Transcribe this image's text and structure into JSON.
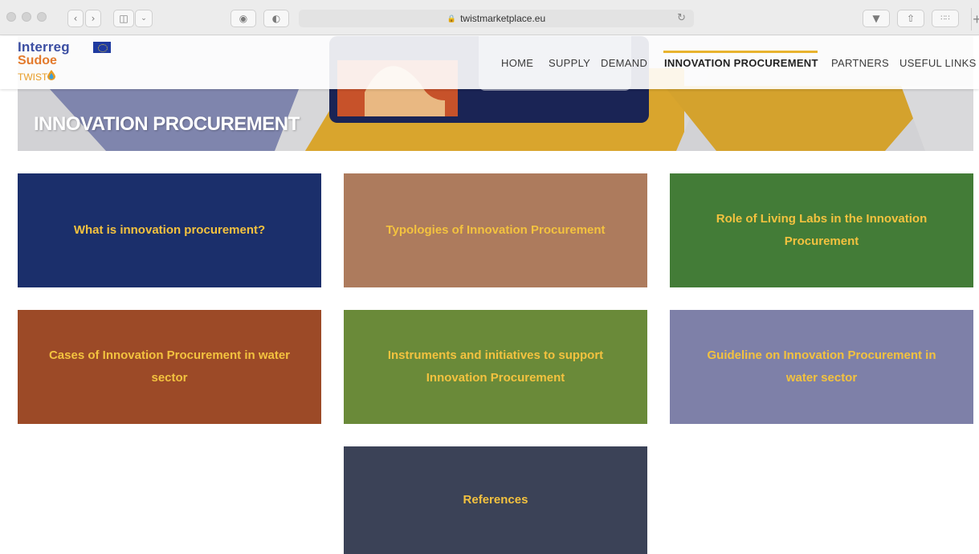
{
  "browser": {
    "url": "twistmarketplace.eu",
    "icons": [
      "back-icon",
      "forward-icon",
      "sidebar-icon",
      "chevron-down-icon",
      "privacy-icon",
      "shield-icon",
      "lock-icon",
      "reload-icon",
      "download-icon",
      "share-icon",
      "tabs-icon",
      "plus-icon"
    ]
  },
  "logo": {
    "interreg": "Interreg",
    "sudoe": "Sudoe",
    "twist": "TWIST"
  },
  "nav": {
    "home": "HOME",
    "supply": "SUPPLY",
    "demand": "DEMAND",
    "innovation": "INNOVATION PROCUREMENT",
    "partners": "PARTNERS",
    "useful_links": "USEFUL LINKS",
    "active": "INNOVATION PROCUREMENT"
  },
  "banner": {
    "title": "INNOVATION PROCUREMENT"
  },
  "tiles": [
    {
      "label": "What is innovation procurement?",
      "color": "#1b2f6b"
    },
    {
      "label": "Typologies of Innovation Procurement",
      "color": "#ad7b5d"
    },
    {
      "label": "Role of Living Labs in the Innovation Procurement",
      "color": "#437c37"
    },
    {
      "label": "Cases of Innovation Procurement in water sector",
      "color": "#9c4a27"
    },
    {
      "label": "Instruments and initiatives to support Innovation Procurement",
      "color": "#6a8a39"
    },
    {
      "label": "Guideline on Innovation Procurement in water sector",
      "color": "#7e80a8"
    },
    {
      "label": "References",
      "color": "#3b4257"
    }
  ],
  "colors": {
    "tile_text": "#f3c23f",
    "accent": "#e8b32e"
  }
}
